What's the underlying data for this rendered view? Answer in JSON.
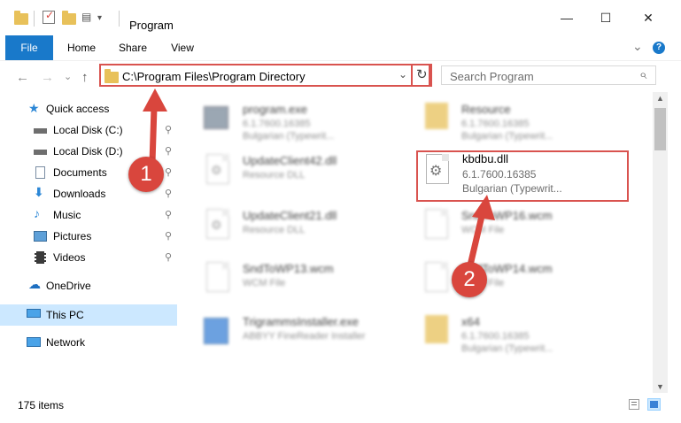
{
  "window": {
    "title": "Program",
    "min_glyph": "—",
    "max_glyph": "☐",
    "close_glyph": "✕"
  },
  "ribbon": {
    "tabs": [
      "File",
      "Home",
      "Share",
      "View"
    ],
    "collapse_glyph": "⌄",
    "help_glyph": "?"
  },
  "nav": {
    "back_glyph": "←",
    "forward_glyph": "→",
    "recent_glyph": "⌄",
    "up_glyph": "↑"
  },
  "address": {
    "path": "C:\\Program Files\\Program Directory",
    "dropdown_glyph": "⌄",
    "refresh_glyph": "↻"
  },
  "search": {
    "placeholder": "Search Program",
    "icon_glyph": "⌕"
  },
  "sidebar": {
    "quick_access": "Quick access",
    "items": [
      {
        "label": "Local Disk (C:)"
      },
      {
        "label": "Local Disk (D:)"
      },
      {
        "label": "Documents"
      },
      {
        "label": "Downloads"
      },
      {
        "label": "Music"
      },
      {
        "label": "Pictures"
      },
      {
        "label": "Videos"
      }
    ],
    "onedrive": "OneDrive",
    "this_pc": "This PC",
    "network": "Network",
    "pin_glyph": "📌"
  },
  "files": [
    {
      "name": "program.exe",
      "line1": "6.1.7600.16385",
      "line2": "Bulgarian (Typewrit..."
    },
    {
      "name": "Resource",
      "line1": "6.1.7600.16385",
      "line2": "Bulgarian (Typewrit..."
    },
    {
      "name": "UpdateClient42.dll",
      "line1": "Resource DLL"
    },
    {
      "name": "kbdbu.dll",
      "line1": "6.1.7600.16385",
      "line2": "Bulgarian (Typewrit..."
    },
    {
      "name": "UpdateClient21.dll",
      "line1": "Resource DLL"
    },
    {
      "name": "SndToWP16.wcm",
      "line1": "WCM File"
    },
    {
      "name": "SndToWP13.wcm",
      "line1": "WCM File"
    },
    {
      "name": "SndToWP14.wcm",
      "line1": "WCM File"
    },
    {
      "name": "TrigrammsInstaller.exe",
      "line1": "ABBYY FineReader Installer"
    },
    {
      "name": "x64",
      "line1": "6.1.7600.16385",
      "line2": "Bulgarian (Typewrit..."
    }
  ],
  "status": {
    "count": "175 items"
  },
  "badges": {
    "one": "1",
    "two": "2"
  },
  "colors": {
    "accent": "#1979ca",
    "annotation": "#d9463d",
    "selected": "#cce8ff"
  }
}
